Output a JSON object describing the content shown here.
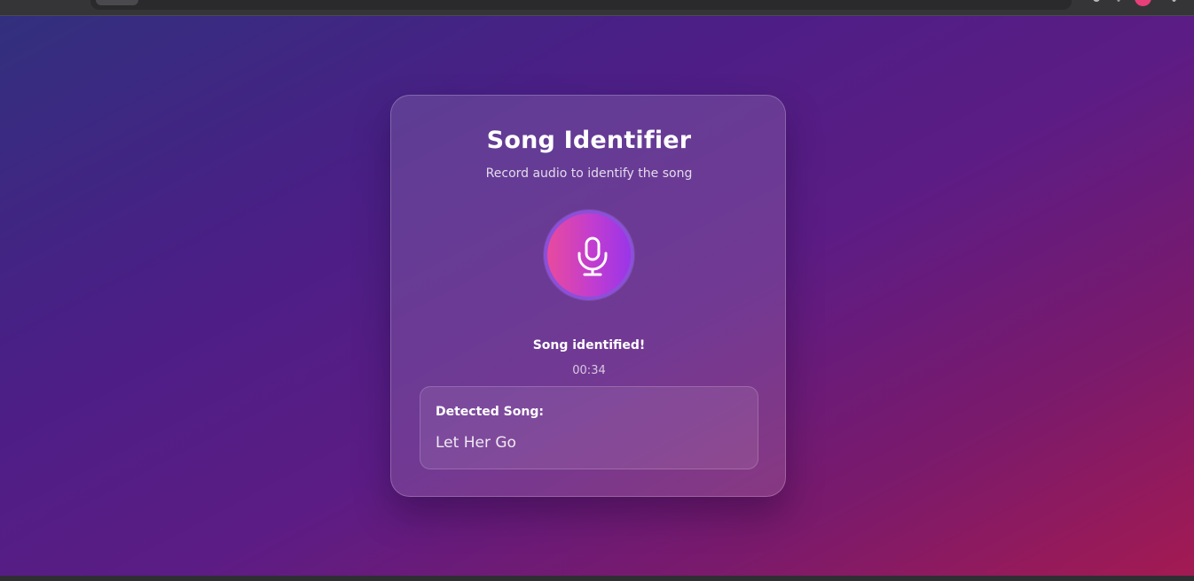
{
  "app": {
    "title": "Song Identifier",
    "subtitle": "Record audio to identify the song"
  },
  "recorder": {
    "button_icon": "microphone-icon",
    "status": "Song identified!",
    "timer": "00:34"
  },
  "result": {
    "label": "Detected Song:",
    "song": "Let Her Go"
  },
  "colors": {
    "background_start": "#32307e",
    "background_end": "#a31a52",
    "mic_gradient_start": "#e84a9e",
    "mic_gradient_end": "#9a35e8",
    "mic_ring": "#8c4fd9",
    "text_primary": "#ffffff"
  }
}
